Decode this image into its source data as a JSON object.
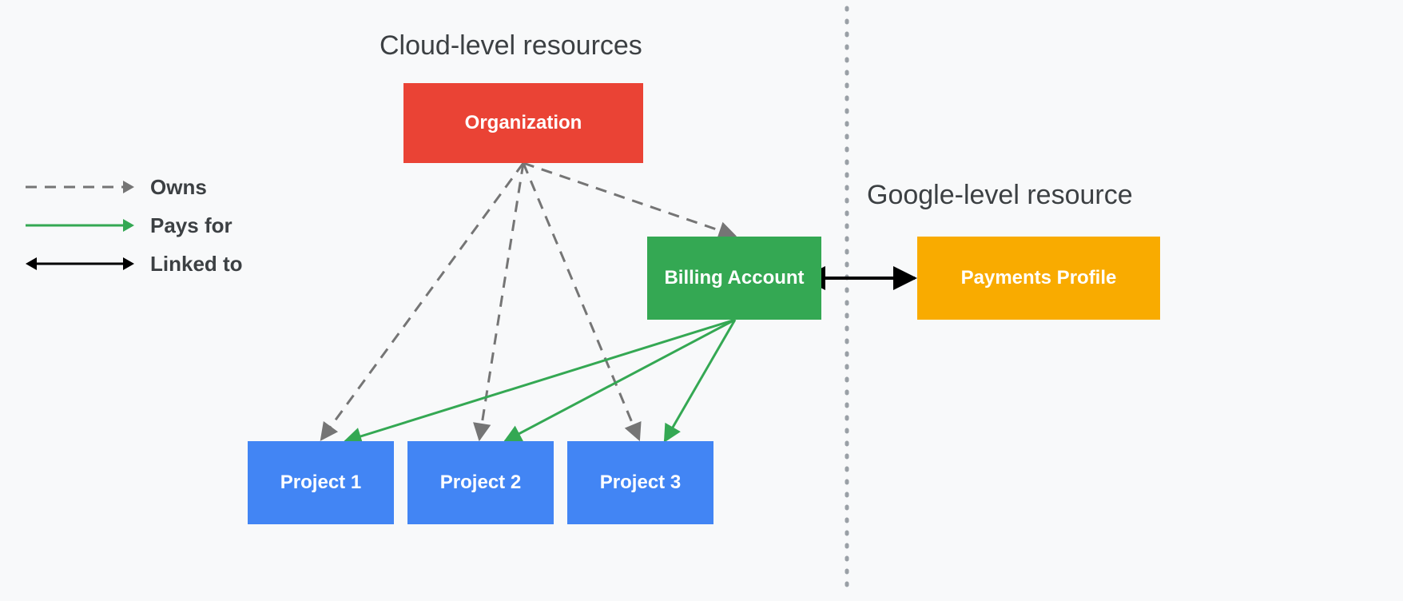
{
  "headings": {
    "cloud": "Cloud-level resources",
    "google": "Google-level resource"
  },
  "nodes": {
    "organization": "Organization",
    "billing": "Billing Account",
    "payments": "Payments Profile",
    "project1": "Project 1",
    "project2": "Project 2",
    "project3": "Project 3"
  },
  "legend": {
    "owns": "Owns",
    "pays": "Pays for",
    "linked": "Linked to"
  },
  "relations": {
    "owns": [
      [
        "organization",
        "project1"
      ],
      [
        "organization",
        "project2"
      ],
      [
        "organization",
        "project3"
      ],
      [
        "organization",
        "billing"
      ]
    ],
    "pays_for": [
      [
        "billing",
        "project1"
      ],
      [
        "billing",
        "project2"
      ],
      [
        "billing",
        "project3"
      ]
    ],
    "linked_to": [
      [
        "billing",
        "payments"
      ]
    ]
  },
  "colors": {
    "grey": "#757575",
    "green": "#34a853",
    "black": "#000000",
    "red": "#ea4335",
    "blue": "#4285f4",
    "yellow": "#f9ab00"
  }
}
